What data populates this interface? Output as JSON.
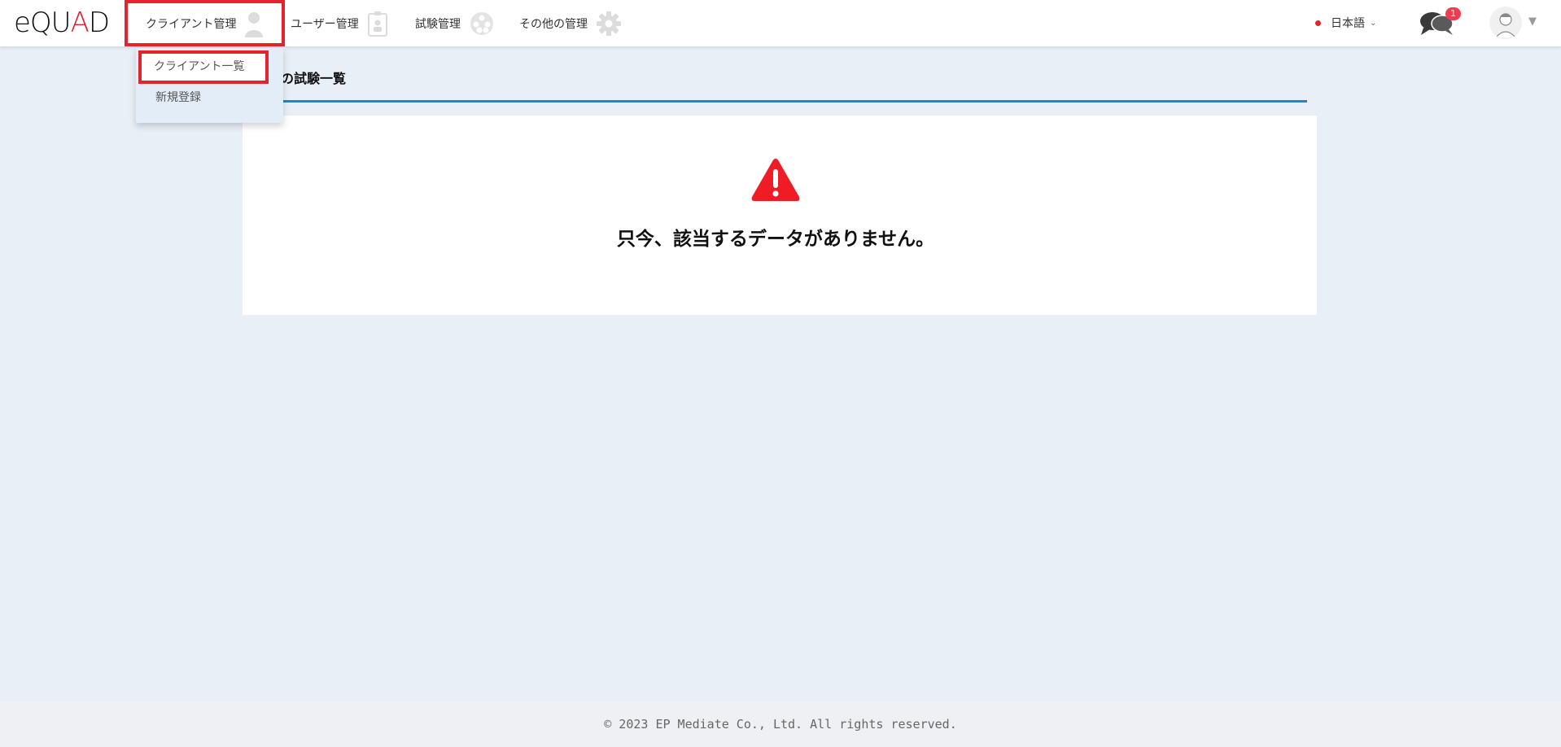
{
  "header": {
    "logo": {
      "prefix": "eQU",
      "accent": "A",
      "suffix": "D"
    },
    "nav": [
      {
        "label": "クライアント管理",
        "icon": "person-icon"
      },
      {
        "label": "ユーザー管理",
        "icon": "id-badge-icon"
      },
      {
        "label": "試験管理",
        "icon": "film-reel-icon"
      },
      {
        "label": "その他の管理",
        "icon": "gear-icon"
      }
    ],
    "language": "日本語",
    "notification_count": "1",
    "chat_icon": "chat-bubbles-icon",
    "avatar_icon": "user-avatar-icon"
  },
  "dropdown": {
    "items": [
      {
        "label": "クライアント一覧"
      },
      {
        "label": "新規登録"
      }
    ]
  },
  "main": {
    "section_title": "の試験一覧",
    "empty_message": "只今、該当するデータがありません。",
    "warning_icon": "warning-triangle-icon"
  },
  "footer": {
    "copyright": "© 2023 EP Mediate Co., Ltd. All rights reserved."
  },
  "colors": {
    "highlight": "#e4232d",
    "accent_line": "#1a8ac4",
    "background": "#e8eff6",
    "badge": "#e8404f",
    "warning": "#ee1c25"
  }
}
